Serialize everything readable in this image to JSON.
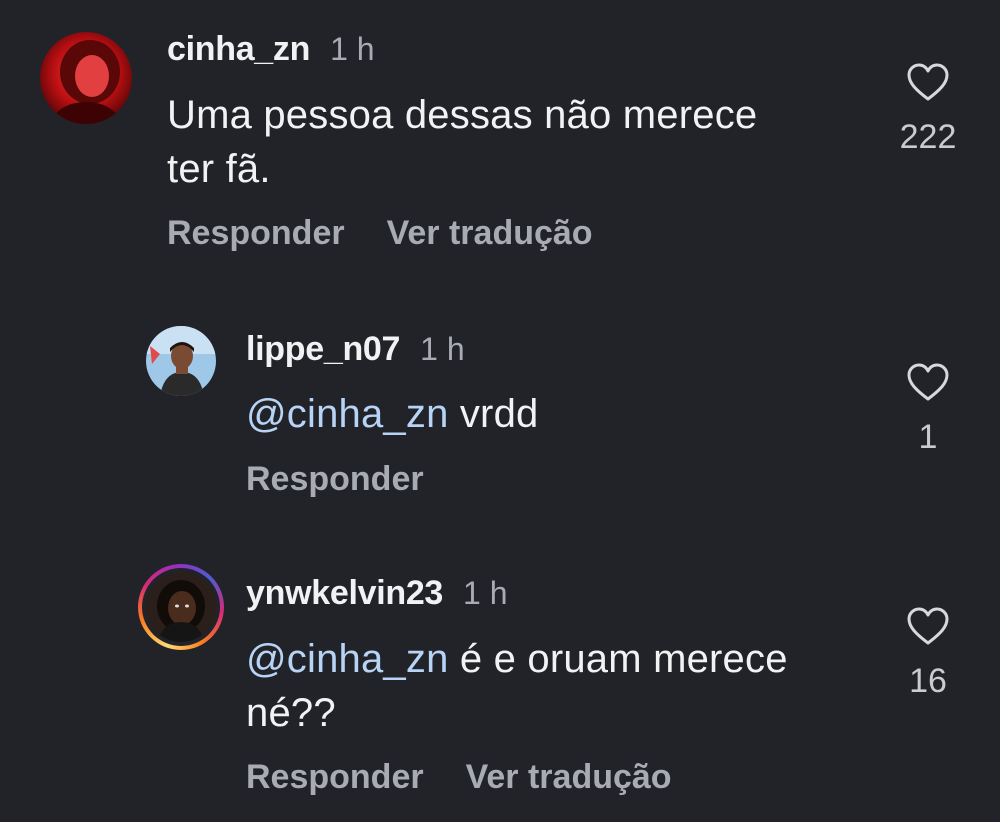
{
  "comments": [
    {
      "username": "cinha_zn",
      "time": "1 h",
      "mention": "",
      "text_line1": "Uma pessoa dessas não merece",
      "text_line2": "ter fã.",
      "reply_label": "Responder",
      "translate_label": "Ver tradução",
      "likes": "222",
      "avatar_icon": "profile-photo-red-tint"
    },
    {
      "username": "lippe_n07",
      "time": "1 h",
      "mention": "@cinha_zn",
      "text_line1": "vrdd",
      "reply_label": "Responder",
      "likes": "1",
      "avatar_icon": "profile-photo-outdoor"
    },
    {
      "username": "ynwkelvin23",
      "time": "1 h",
      "mention": "@cinha_zn",
      "text_line1": "é e oruam merece",
      "text_line2": "né??",
      "reply_label": "Responder",
      "translate_label": "Ver tradução",
      "likes": "16",
      "avatar_icon": "profile-photo-story-ring"
    }
  ],
  "colors": {
    "background": "#212328",
    "text": "#f2f2f4",
    "muted": "#a9abb3",
    "mention": "#b7d3f5"
  }
}
